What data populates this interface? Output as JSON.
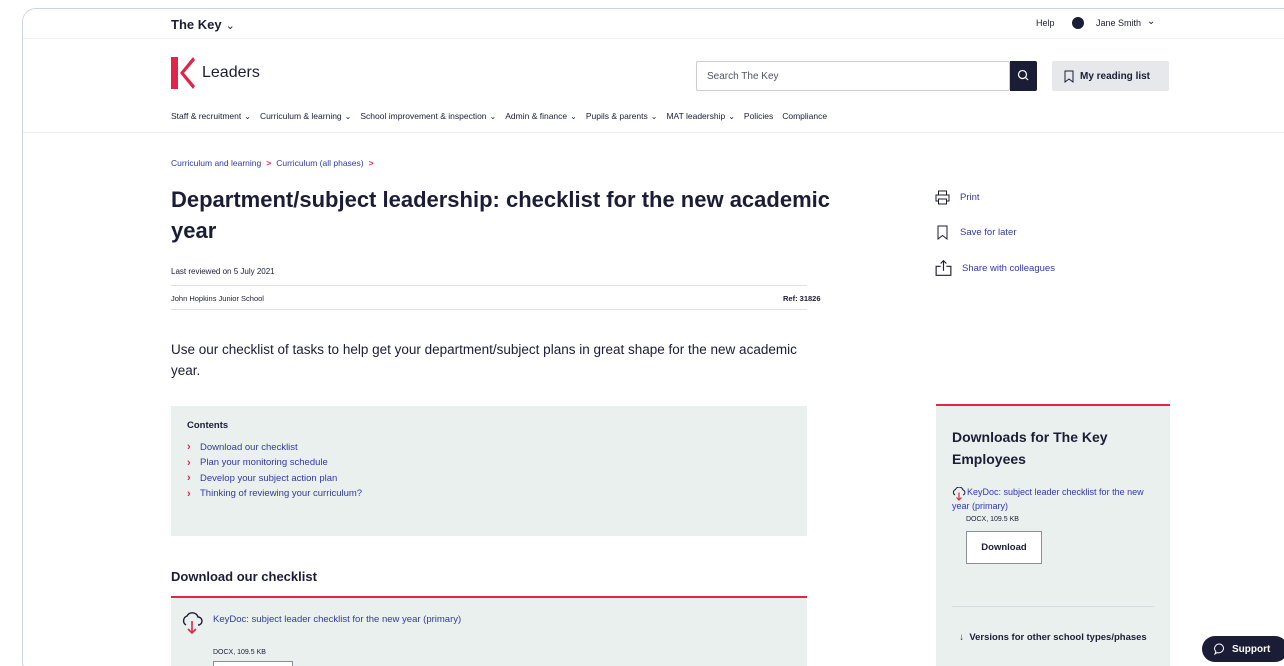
{
  "topbar": {
    "brand": "The Key",
    "help": "Help",
    "user_name": "Jane Smith"
  },
  "header": {
    "logo_text": "Leaders",
    "search_placeholder": "Search The Key",
    "reading_list": "My reading list"
  },
  "nav": {
    "items": [
      {
        "label": "Staff & recruitment",
        "has_menu": true
      },
      {
        "label": "Curriculum & learning",
        "has_menu": true
      },
      {
        "label": "School improvement & inspection",
        "has_menu": true
      },
      {
        "label": "Admin & finance",
        "has_menu": true
      },
      {
        "label": "Pupils & parents",
        "has_menu": true
      },
      {
        "label": "MAT leadership",
        "has_menu": true
      },
      {
        "label": "Policies",
        "has_menu": false
      },
      {
        "label": "Compliance",
        "has_menu": false
      }
    ]
  },
  "breadcrumb": [
    "Curriculum and learning",
    "Curriculum (all phases)"
  ],
  "article": {
    "title": "Department/subject leadership: checklist for the new academic year",
    "reviewed": "Last reviewed on 5 July 2021",
    "school": "John Hopkins Junior School",
    "ref": "Ref: 31826",
    "intro": "Use our checklist of tasks to help get your department/subject plans in great shape for the new academic year."
  },
  "contents": {
    "title": "Contents",
    "items": [
      "Download our checklist",
      "Plan your monitoring schedule",
      "Develop your subject action plan",
      "Thinking of reviewing your curriculum?"
    ]
  },
  "download_section": {
    "heading": "Download our checklist",
    "link": "KeyDoc: subject leader checklist for the new year (primary)",
    "meta": "DOCX, 109.5 KB"
  },
  "actions": {
    "print": "Print",
    "save": "Save for later",
    "share": "Share with colleagues"
  },
  "side_downloads": {
    "title": "Downloads for The Key Employees",
    "link": "KeyDoc: subject leader checklist for the new year (primary)",
    "meta": "DOCX, 109.5 KB",
    "button": "Download",
    "versions": "Versions for other school types/phases"
  },
  "support": "Support",
  "colors": {
    "navy": "#1b1d36",
    "accent_red": "#e0244a",
    "link_blue": "#2f3aa5",
    "panel_green": "#eaf0ed"
  }
}
